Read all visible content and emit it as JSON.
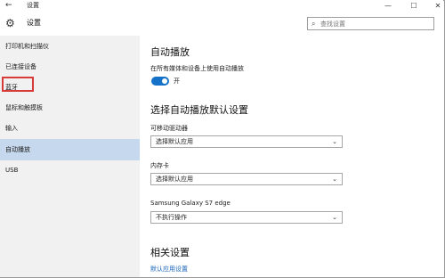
{
  "titlebar": {
    "back_glyph": "←",
    "title": "设置",
    "min_glyph": "—",
    "max_glyph": "☐",
    "close_glyph": "✕"
  },
  "header": {
    "icon": "gear-icon",
    "title": "设置",
    "search": {
      "placeholder": "查找设置",
      "icon": "search-icon"
    }
  },
  "sidebar": {
    "items": [
      {
        "label": "打印机和扫描仪"
      },
      {
        "label": "已连接设备"
      },
      {
        "label": "蓝牙",
        "highlighted_box_color": "#d83a3a"
      },
      {
        "label": "鼠标和触摸板"
      },
      {
        "label": "输入"
      },
      {
        "label": "自动播放",
        "active": true
      },
      {
        "label": "USB"
      }
    ]
  },
  "content": {
    "autoplay": {
      "title": "自动播放",
      "toggle_label": "在所有媒体和设备上使用自动播放",
      "toggle_state": "开",
      "toggle_on": true
    },
    "defaults": {
      "title": "选择自动播放默认设置",
      "removable": {
        "label": "可移动驱动器",
        "value": "选择默认应用"
      },
      "memory_card": {
        "label": "内存卡",
        "value": "选择默认应用"
      },
      "device": {
        "label": "Samsung Galaxy S7 edge",
        "value": "不执行操作"
      }
    },
    "related": {
      "title": "相关设置",
      "link": "默认应用设置"
    }
  },
  "colors": {
    "accent": "#1672c9",
    "sidebar_bg": "#f1f1f1",
    "active_item_bg": "#c6d8ed",
    "link": "#1a64b8"
  }
}
